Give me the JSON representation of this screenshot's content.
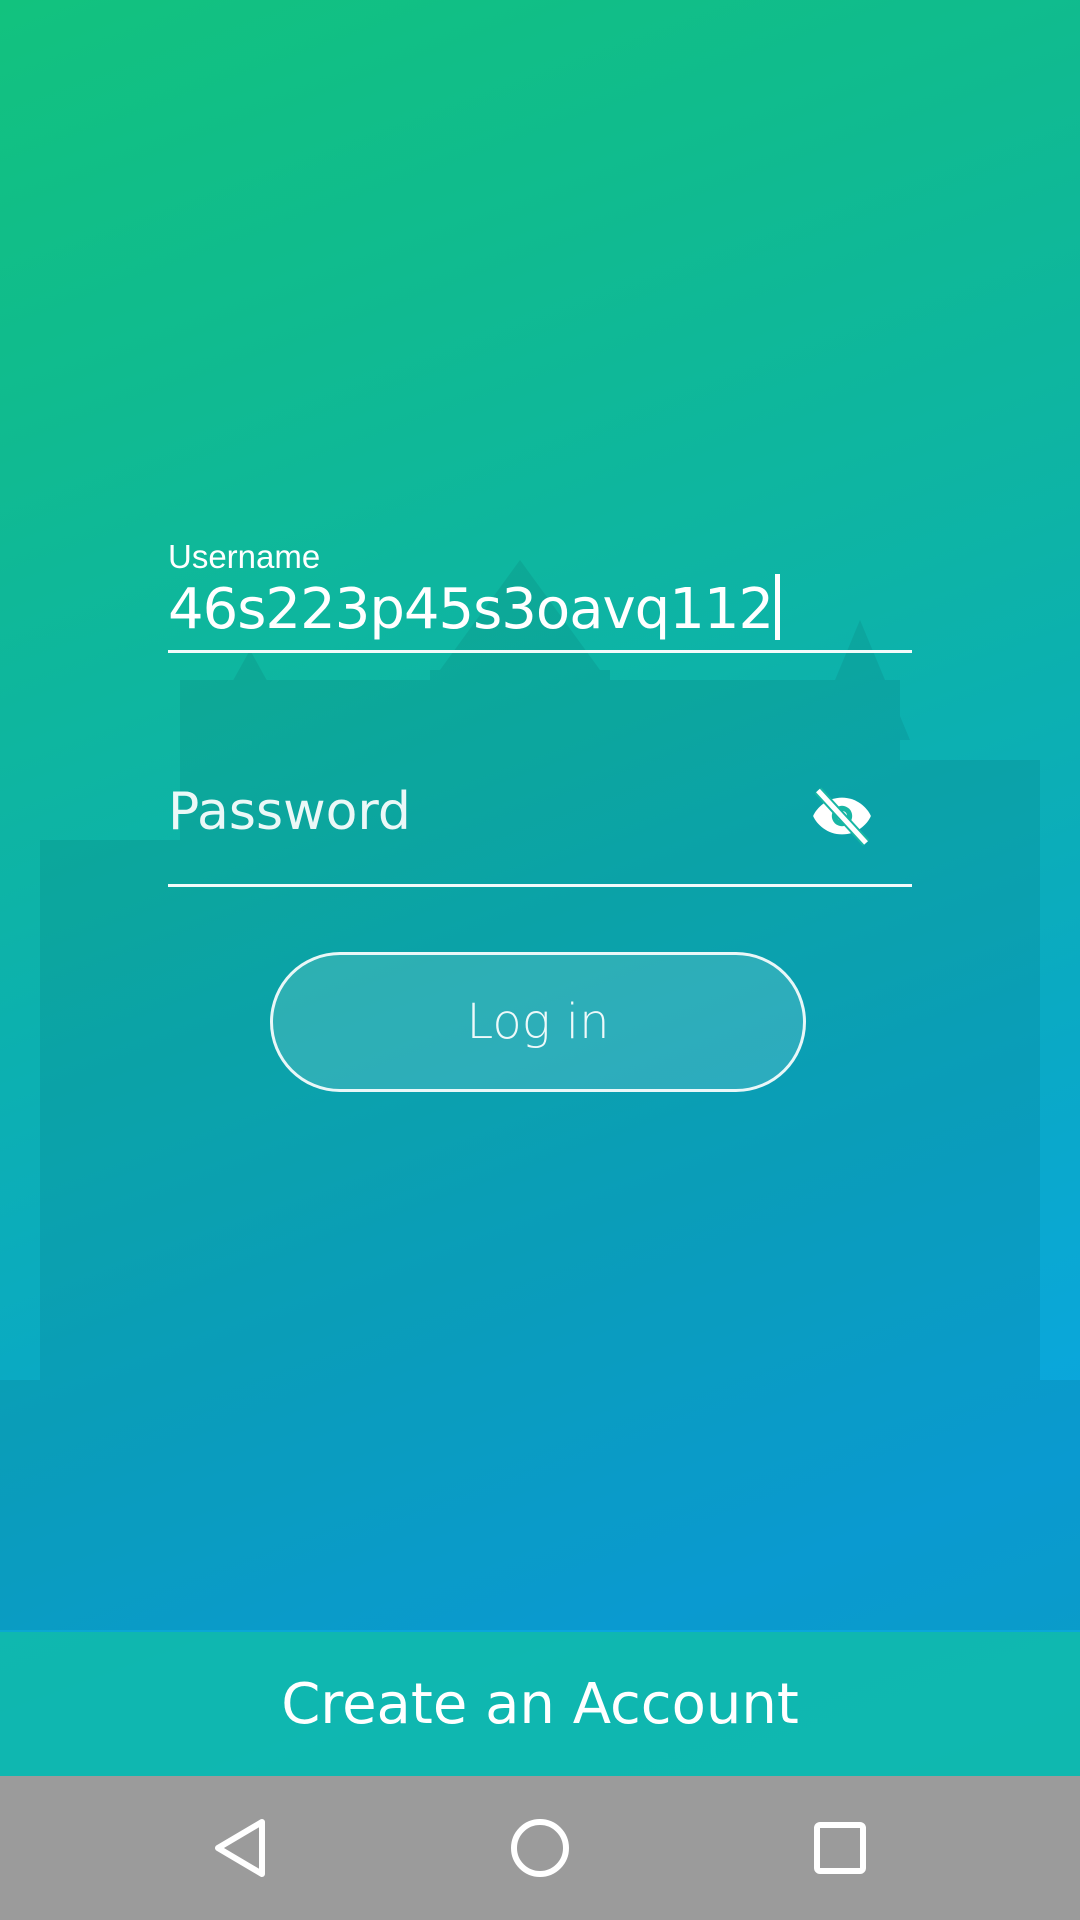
{
  "login": {
    "username_label": "Username",
    "username_value": "46s223p45s3oavq112",
    "password_placeholder": "Password",
    "login_label": "Log in"
  },
  "footer": {
    "create_account_label": "Create an Account"
  },
  "icons": {
    "password_toggle": "eye-off-icon",
    "nav_back": "back-triangle-icon",
    "nav_home": "home-circle-icon",
    "nav_recents": "recents-square-icon"
  },
  "colors": {
    "gradient_top": "#12c27e",
    "gradient_bottom": "#0aa6e0",
    "create_bar": "#10baaa",
    "nav_bar": "#9b9b9b",
    "text": "#ffffff"
  }
}
